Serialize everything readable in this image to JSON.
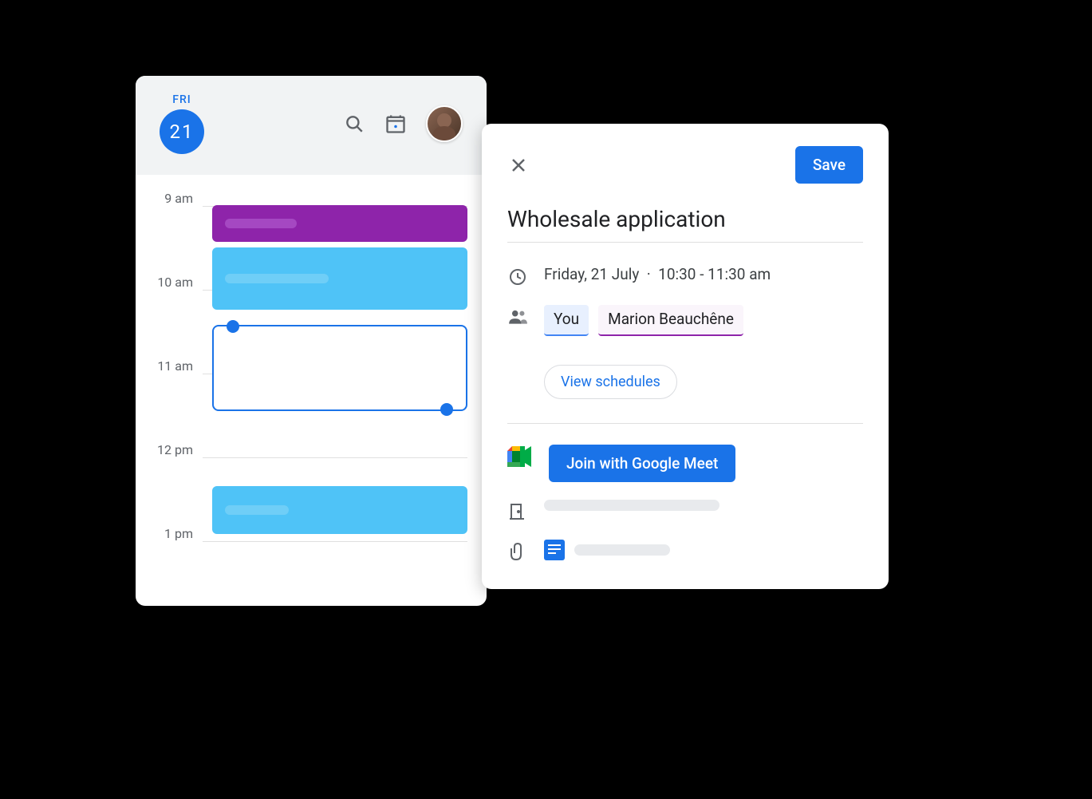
{
  "calendar": {
    "day_label": "FRI",
    "day_number": "21",
    "time_labels": [
      "9 am",
      "10 am",
      "11 am",
      "12 pm",
      "1 pm"
    ]
  },
  "event": {
    "save_label": "Save",
    "title": "Wholesale application",
    "date_text": "Friday, 21 July",
    "time_text": "10:30 - 11:30 am",
    "separator": "·",
    "attendees": {
      "you": "You",
      "other": "Marion Beauchêne"
    },
    "view_schedules_label": "View schedules",
    "meet_label": "Join with Google Meet"
  }
}
